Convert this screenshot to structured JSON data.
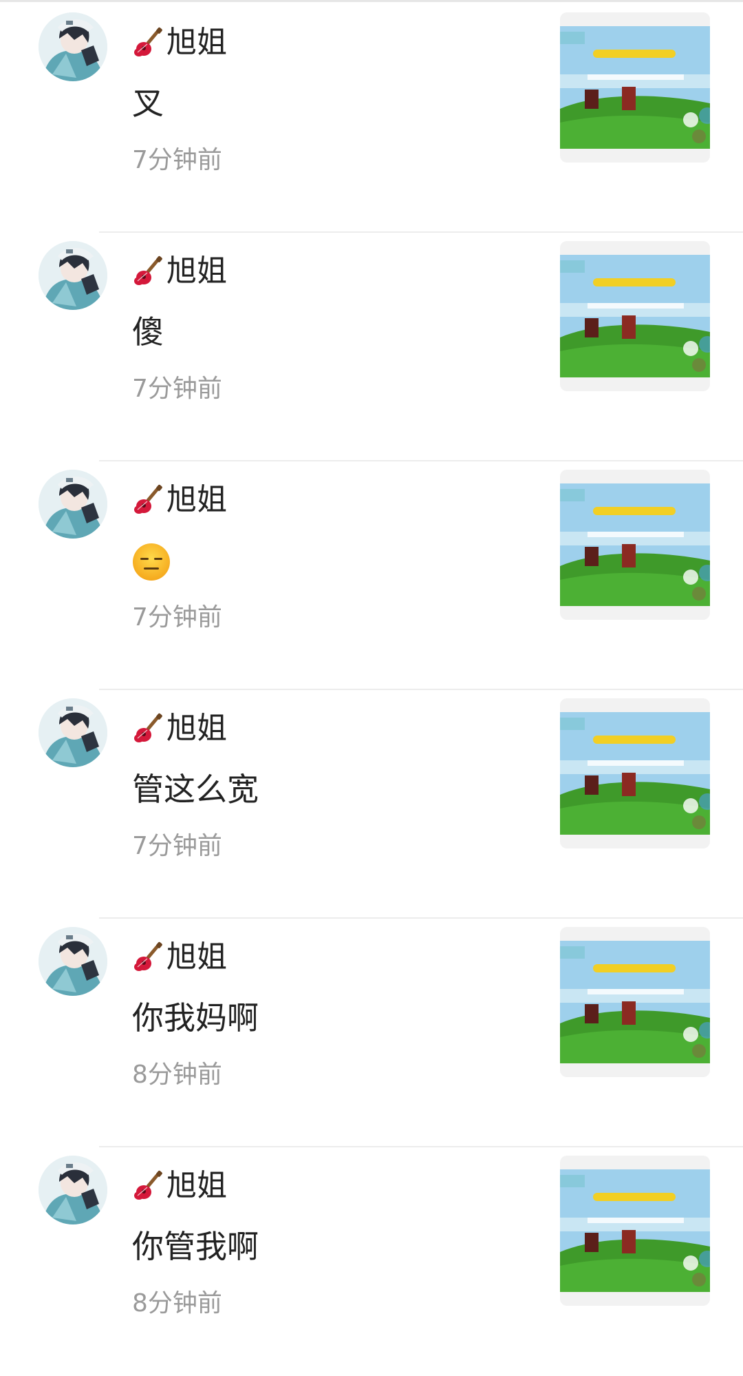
{
  "comments": [
    {
      "username": "旭姐",
      "message": "叉",
      "emoji": "",
      "time": "7分钟前"
    },
    {
      "username": "旭姐",
      "message": "傻",
      "emoji": "",
      "time": "7分钟前"
    },
    {
      "username": "旭姐",
      "message": "",
      "emoji": "expressionless-face",
      "time": "7分钟前"
    },
    {
      "username": "旭姐",
      "message": "管这么宽",
      "emoji": "",
      "time": "7分钟前"
    },
    {
      "username": "旭姐",
      "message": "你我妈啊",
      "emoji": "",
      "time": "8分钟前"
    },
    {
      "username": "旭姐",
      "message": "你管我啊",
      "emoji": "",
      "time": "8分钟前"
    }
  ],
  "icons": {
    "username_prefix": "guitar-icon",
    "avatar": "anime-character-avatar",
    "thumbnail": "game-screenshot-thumbnail"
  },
  "colors": {
    "name_text": "#222222",
    "time_text": "#9a9a9a",
    "divider": "#ececec"
  }
}
